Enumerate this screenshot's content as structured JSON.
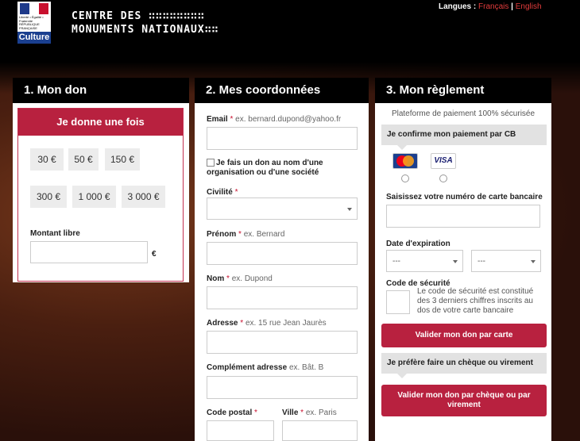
{
  "header": {
    "logo_flag_text": "Liberté • Égalité • Fraternité RÉPUBLIQUE FRANÇAISE",
    "logo_ministry": "Ministère",
    "logo_culture": "Culture",
    "brand_line1": "CENTRE DES ∷∷∷∷∷∷∷∷",
    "brand_line2": "MONUMENTS NATIONAUX∷∷",
    "lang_label": "Langues : ",
    "lang_fr": "Français",
    "lang_sep": " | ",
    "lang_en": "English"
  },
  "panel1": {
    "title": "1. Mon don",
    "box_title": "Je donne une fois",
    "amounts": [
      "30 €",
      "50 €",
      "150 €",
      "300 €",
      "1 000 €",
      "3 000 €"
    ],
    "free_label": "Montant libre",
    "currency": "€"
  },
  "panel2": {
    "title": "2. Mes coordonnées",
    "email_label": "Email",
    "email_ex": "ex. bernard.dupond@yahoo.fr",
    "org_label": "Je fais un don au nom d'une organisation ou d'une société",
    "civilite_label": "Civilité",
    "prenom_label": "Prénom",
    "prenom_ex": "ex. Bernard",
    "nom_label": "Nom",
    "nom_ex": "ex. Dupond",
    "adresse_label": "Adresse",
    "adresse_ex": "ex. 15 rue Jean Jaurès",
    "complement_label": "Complément adresse",
    "complement_ex": "ex. Bât. B",
    "cp_label": "Code postal",
    "ville_label": "Ville",
    "ville_ex": "ex. Paris",
    "req": "*"
  },
  "panel3": {
    "title": "3. Mon règlement",
    "secure": "Plateforme de paiement 100% sécurisée",
    "cb_header": "Je confirme mon paiement par CB",
    "mastercard": "MasterCard",
    "visa": "VISA",
    "card_number_label": "Saisissez votre numéro de carte bancaire",
    "expiry_label": "Date d'expiration",
    "expiry_month": "---",
    "expiry_year": "---",
    "cvv_label": "Code de sécurité",
    "cvv_help": "Le code de sécurité est constitué des 3 derniers chiffres inscrits au dos de votre carte bancaire",
    "pay_card_btn": "Valider mon don par carte",
    "alt_header": "Je préfère faire un chèque ou virement",
    "pay_alt_btn": "Valider mon don par chèque ou par virement"
  },
  "colors": {
    "accent": "#b8213f",
    "header_bg": "#000000",
    "link_red": "#e23c3c"
  }
}
